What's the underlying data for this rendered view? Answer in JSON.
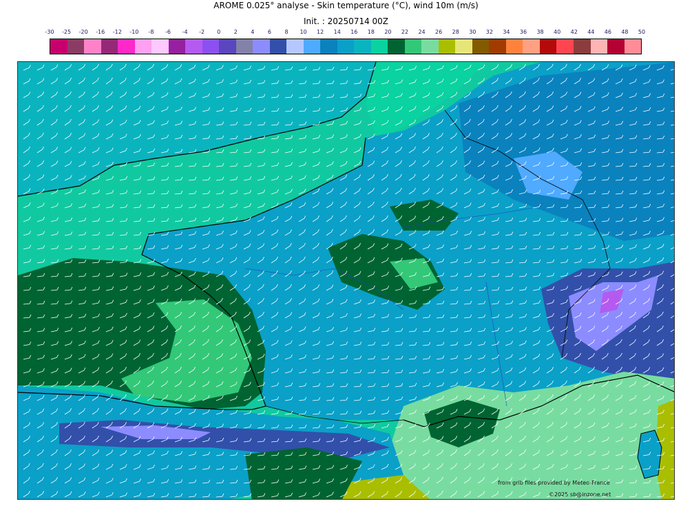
{
  "title": "AROME 0.025° analyse - Skin temperature (°C), wind 10m (m/s)",
  "subtitle": "Init. : 20250714 00Z",
  "colorbar": {
    "ticks": [
      "-30",
      "-25",
      "-20",
      "-16",
      "-12",
      "-10",
      "-8",
      "-6",
      "-4",
      "-2",
      "0",
      "2",
      "4",
      "6",
      "8",
      "10",
      "12",
      "14",
      "16",
      "18",
      "20",
      "22",
      "24",
      "26",
      "28",
      "30",
      "32",
      "34",
      "36",
      "38",
      "40",
      "42",
      "44",
      "46",
      "48",
      "50"
    ],
    "colors": [
      "#c8006e",
      "#8c3c64",
      "#ff82c8",
      "#962878",
      "#ff28c8",
      "#ffa0f0",
      "#ffc8ff",
      "#9620a0",
      "#b45af0",
      "#8c50f0",
      "#5a46be",
      "#8282aa",
      "#8c8cff",
      "#3250aa",
      "#b4c8ff",
      "#50aaff",
      "#0a82be",
      "#0aa0c8",
      "#0ab4be",
      "#0ad2a0",
      "#006432",
      "#32c878",
      "#78dca0",
      "#aabe00",
      "#e6e678",
      "#825a00",
      "#a03c00",
      "#ff823c",
      "#ffa082",
      "#b40a0a",
      "#ff4650",
      "#8c3c3c",
      "#ffb4b4",
      "#b40032",
      "#ff8c96"
    ]
  },
  "credits": {
    "source": "from grib files provided by Meteo-France",
    "copyright": "©2025 sb@inzone.net"
  }
}
